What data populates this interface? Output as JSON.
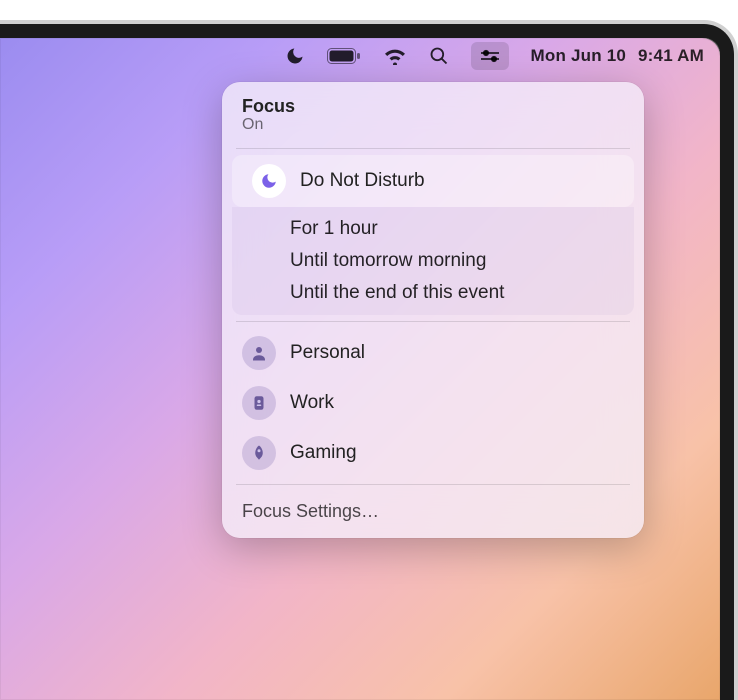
{
  "menubar": {
    "datetime_date": "Mon Jun 10",
    "datetime_time": "9:41 AM"
  },
  "popover": {
    "title": "Focus",
    "subtitle": "On",
    "dnd_label": "Do Not Disturb",
    "sub_options": {
      "0": "For 1 hour",
      "1": "Until tomorrow morning",
      "2": "Until the end of this event"
    },
    "modes": {
      "personal": "Personal",
      "work": "Work",
      "gaming": "Gaming"
    },
    "footer": "Focus Settings…"
  },
  "colors": {
    "accent_purple": "#7b61e8"
  }
}
